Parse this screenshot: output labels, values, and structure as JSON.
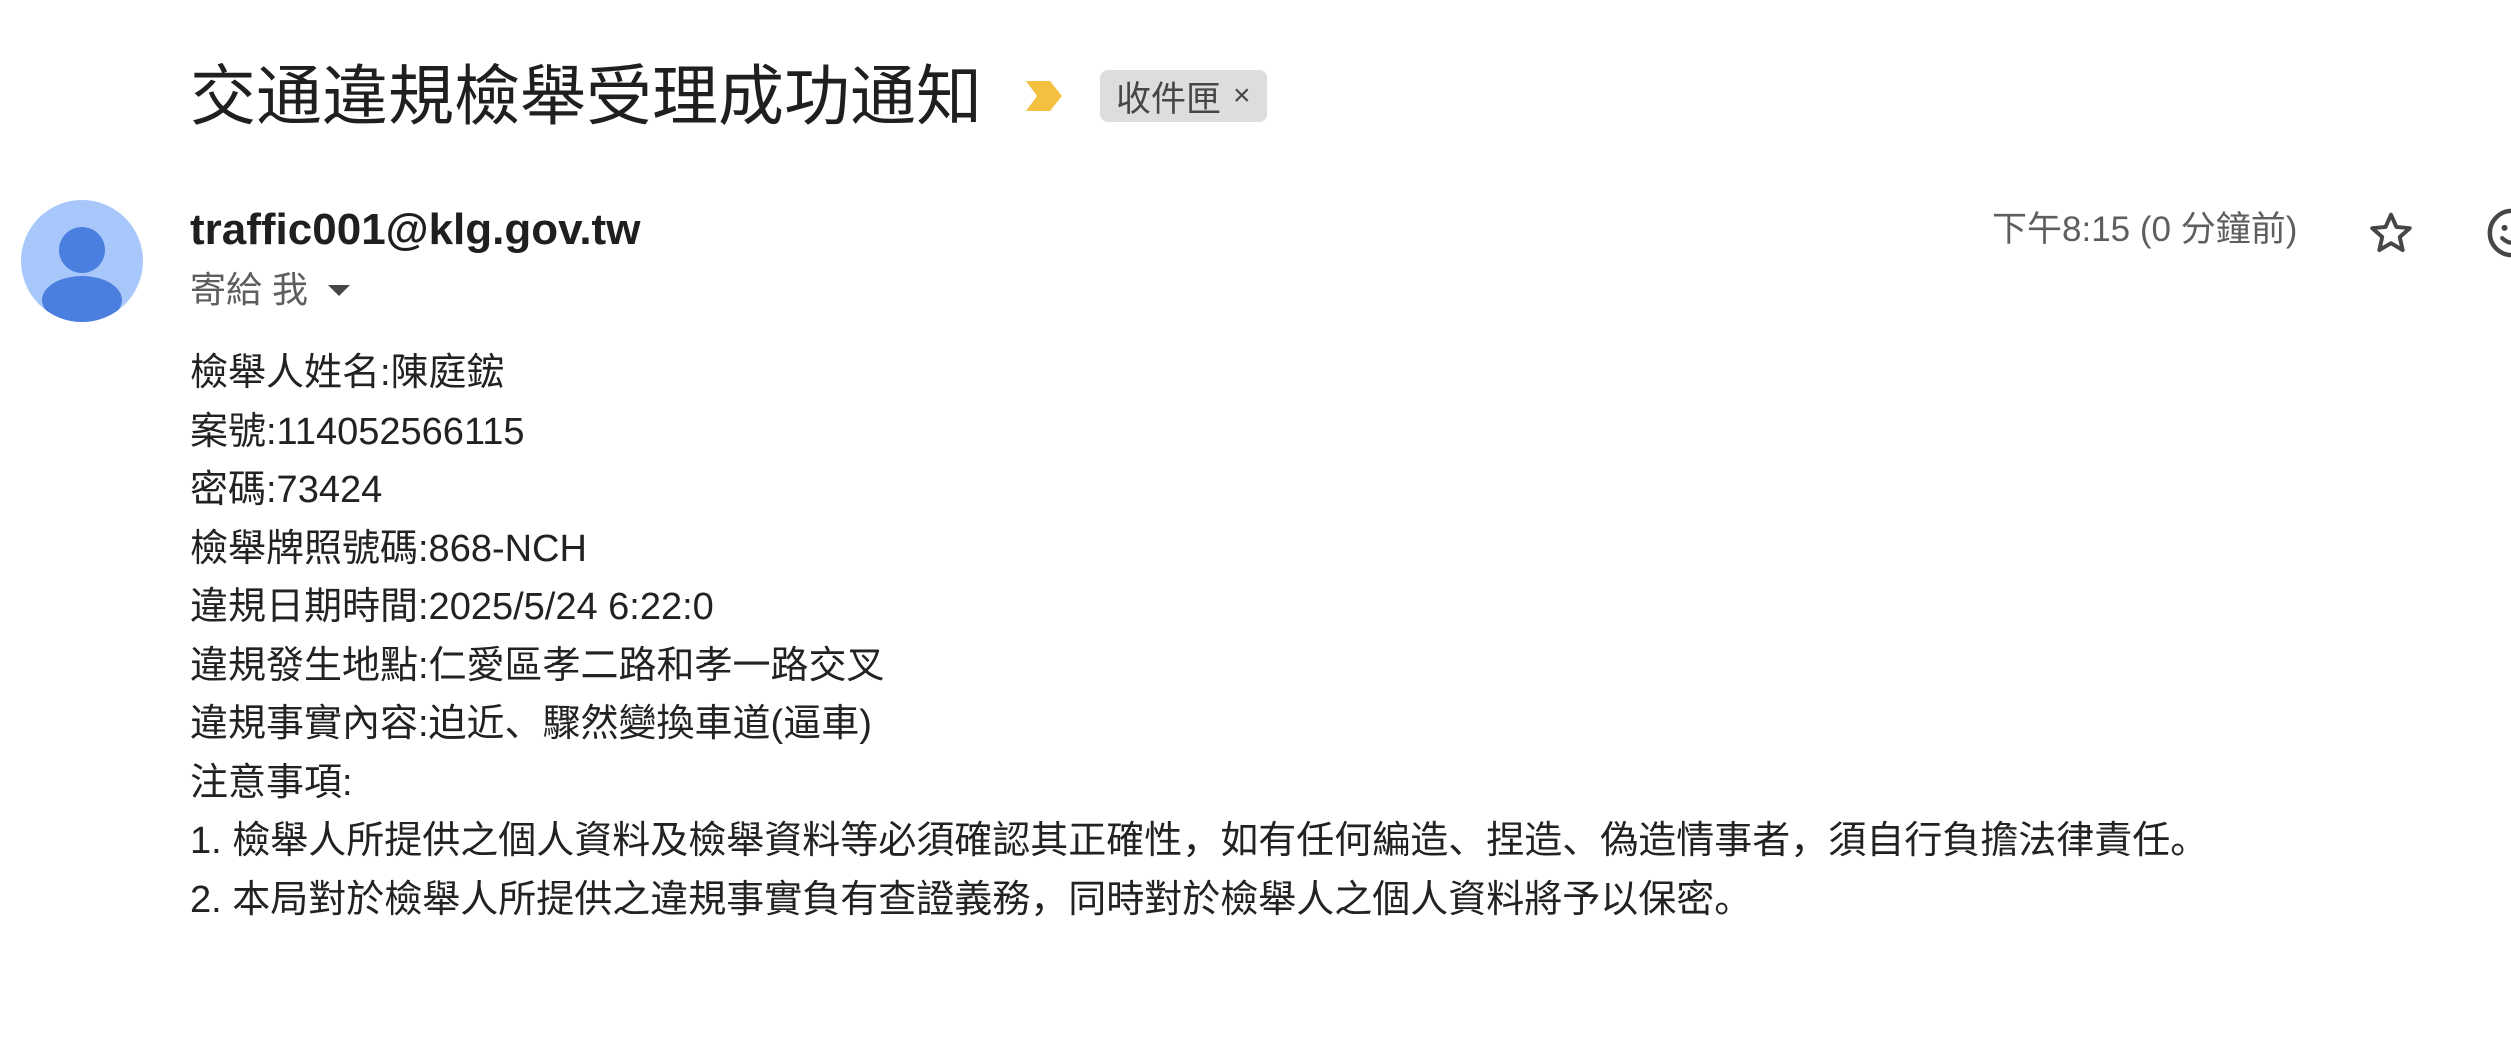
{
  "email": {
    "subject": "交通違規檢舉受理成功通知",
    "label": "收件匣",
    "label_close": "×",
    "sender": "traffic001@klg.gov.tw",
    "recipient_line": "寄給 我",
    "timestamp": "下午8:15 (0 分鐘前)",
    "body_lines": [
      "檢舉人姓名:陳庭鋐",
      "案號:114052566115",
      "密碼:73424",
      "檢舉牌照號碼:868-NCH",
      "違規日期時間:2025/5/24 6:22:0",
      "違規發生地點:仁愛區孝二路和孝一路交叉",
      "違規事實內容:迫近、驟然變換車道(逼車)",
      "注意事項:",
      "1. 檢舉人所提供之個人資料及檢舉資料等必須確認其正確性，如有任何編造、捏造、偽造情事者，須自行負擔法律責任。",
      "2. 本局對於檢舉人所提供之違規事實負有查證義務，同時對於檢舉人之個人資料將予以保密。"
    ]
  },
  "icons": {
    "importance": "importance-marker-icon",
    "avatar": "person-avatar-icon",
    "caret": "chevron-down-icon",
    "star": "star-icon",
    "emoji": "emoji-reaction-icon"
  },
  "colors": {
    "importance_marker": "#f4c042",
    "avatar_bg": "#a8c7fa",
    "avatar_figure": "#4a7fe0",
    "chip_bg": "#dddddd"
  }
}
